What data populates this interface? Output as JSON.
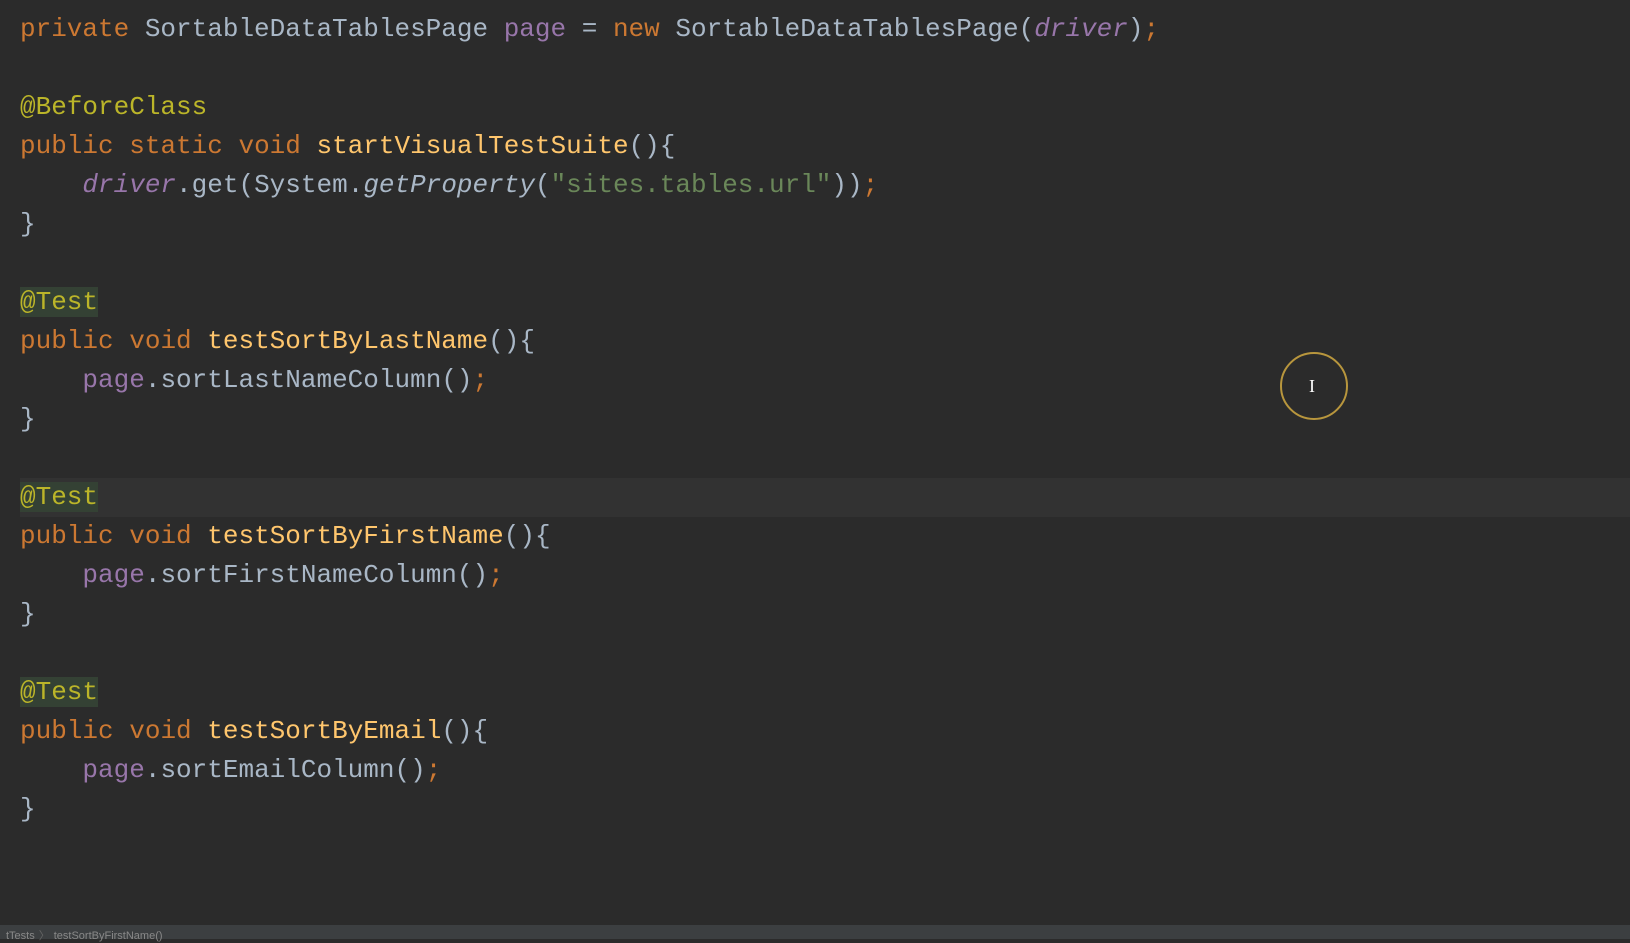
{
  "code": {
    "line1": {
      "kw_private": "private",
      "type1": "SortableDataTablesPage",
      "field_page": "page",
      "eq": "=",
      "kw_new": "new",
      "type2": "SortableDataTablesPage",
      "lparen": "(",
      "param_driver": "driver",
      "rparen": ")",
      "semi": ";"
    },
    "block1": {
      "annotation": "@BeforeClass",
      "kw_public": "public",
      "kw_static": "static",
      "kw_void": "void",
      "method_name": "startVisualTestSuite",
      "parens": "()",
      "lbrace": "{",
      "body_driver": "driver",
      "dot1": ".",
      "body_get": "get",
      "lparen2": "(",
      "system": "System",
      "dot2": ".",
      "getprop": "getProperty",
      "lparen3": "(",
      "str": "\"sites.tables.url\"",
      "rparen3": ")",
      "rparen2": ")",
      "semi": ";",
      "rbrace": "}"
    },
    "block2": {
      "annotation": "@Test",
      "kw_public": "public",
      "kw_void": "void",
      "method_name": "testSortByLastName",
      "parens": "()",
      "lbrace": "{",
      "body_page": "page",
      "dot": ".",
      "body_call": "sortLastNameColumn",
      "body_parens": "()",
      "semi": ";",
      "rbrace": "}"
    },
    "block3": {
      "annotation": "@Test",
      "kw_public": "public",
      "kw_void": "void",
      "method_name": "testSortByFirstName",
      "parens": "()",
      "lbrace": "{",
      "body_page": "page",
      "dot": ".",
      "body_call": "sortFirstNameColumn",
      "body_parens": "()",
      "semi": ";",
      "rbrace": "}"
    },
    "block4": {
      "annotation": "@Test",
      "kw_public": "public",
      "kw_void": "void",
      "method_name": "testSortByEmail",
      "parens": "()",
      "lbrace": "{",
      "body_page": "page",
      "dot": ".",
      "body_call": "sortEmailColumn",
      "body_parens": "()",
      "semi": ";",
      "rbrace": "}"
    }
  },
  "breadcrumb": {
    "item1": "tTests",
    "item2": "testSortByFirstName()"
  }
}
